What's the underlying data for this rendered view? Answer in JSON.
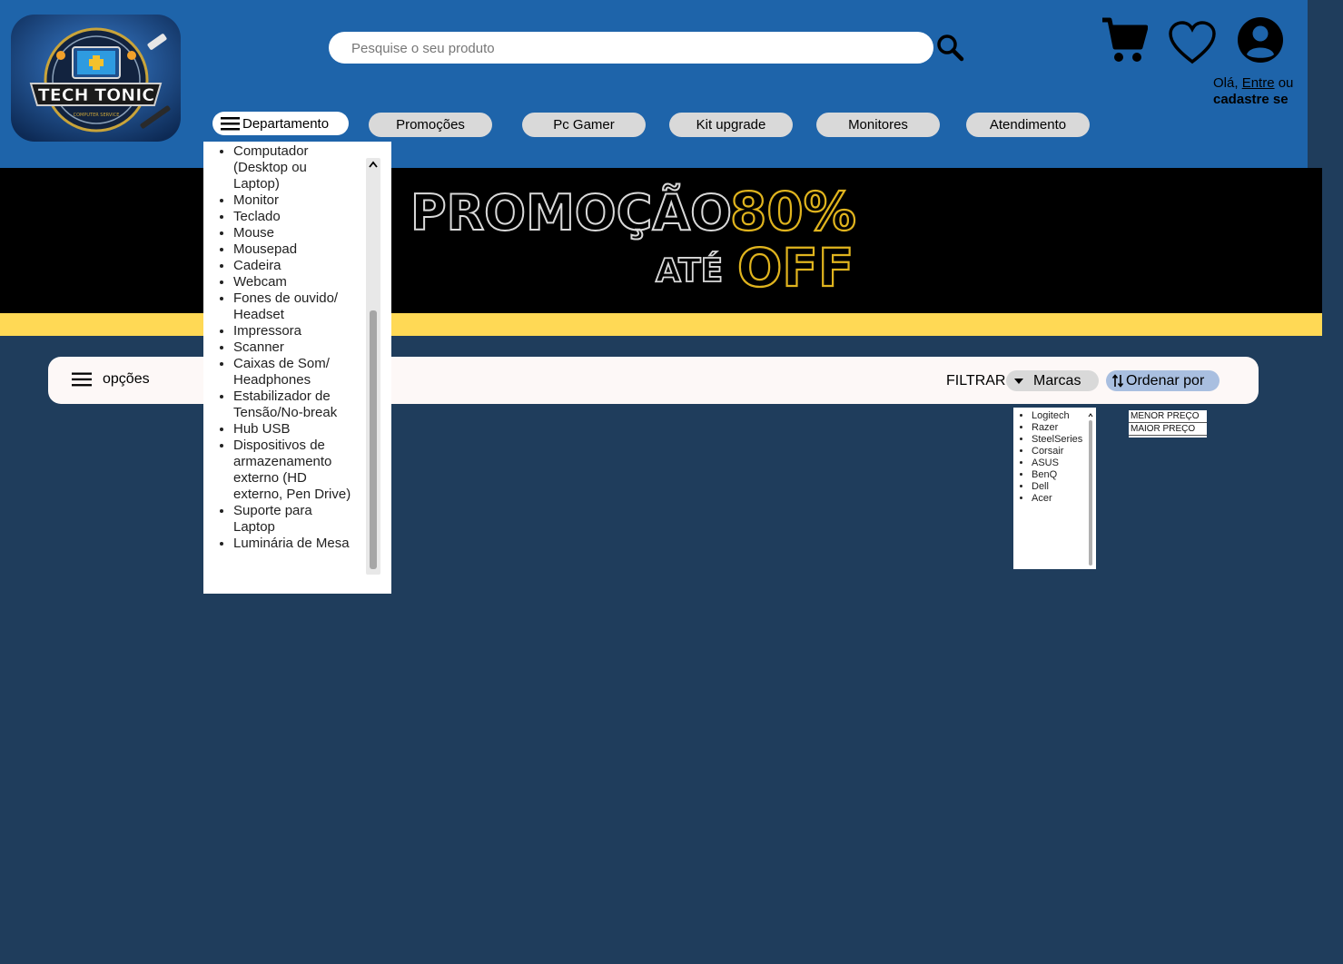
{
  "header": {
    "logo_text": "TECH TONIC",
    "logo_subtext": "COMPUTER SERVICE",
    "search_placeholder": "Pesquise o seu produto",
    "greeting_prefix": "Olá, ",
    "login_link": "Entre",
    "greeting_mid": " ou",
    "signup_link": "cadastre se"
  },
  "nav": {
    "department_label": "Departamento",
    "items": [
      {
        "label": "Promoções"
      },
      {
        "label": "Pc Gamer"
      },
      {
        "label": "Kit upgrade"
      },
      {
        "label": "Monitores"
      },
      {
        "label": "Atendimento"
      }
    ]
  },
  "department_menu": {
    "items": [
      "Computador (Desktop ou Laptop)",
      "Monitor",
      "Teclado",
      "Mouse",
      "Mousepad",
      "Cadeira",
      "Webcam",
      "Fones de ouvido/ Headset",
      "Impressora",
      "Scanner",
      "Caixas de Som/ Headphones",
      "Estabilizador de Tensão/No-break",
      "Hub USB",
      "Dispositivos de armazenamento externo (HD externo, Pen Drive)",
      "Suporte para Laptop",
      "Luminária de Mesa"
    ]
  },
  "banner": {
    "line1": "PROMOÇÃO",
    "percent": "80%",
    "line2": "ATÉ",
    "off": "OFF"
  },
  "options_bar": {
    "options_label": "opções",
    "filter_label": "FILTRAR:",
    "brands_label": "Marcas",
    "sort_label": "Ordenar por"
  },
  "brands": [
    "Logitech",
    "Razer",
    "SteelSeries",
    "Corsair",
    "ASUS",
    "BenQ",
    "Dell",
    "Acer"
  ],
  "sort_options": [
    "MENOR PREÇO",
    "MAIOR  PREÇO"
  ],
  "colors": {
    "header_bg": "#1e64aa",
    "page_bg": "#1f3d5c",
    "banner_bg": "#000000",
    "banner_stripe": "#ffd955",
    "banner_accent": "#e0b41e",
    "pill_bg": "#d9d9d9",
    "sort_bg": "#a9bfe0"
  },
  "icons": {
    "search": "search-icon",
    "cart": "cart-icon",
    "favorites": "heart-icon",
    "account": "account-icon",
    "menu": "hamburger-icon",
    "dropdown": "caret-down-icon",
    "sort": "sort-arrows-icon"
  }
}
